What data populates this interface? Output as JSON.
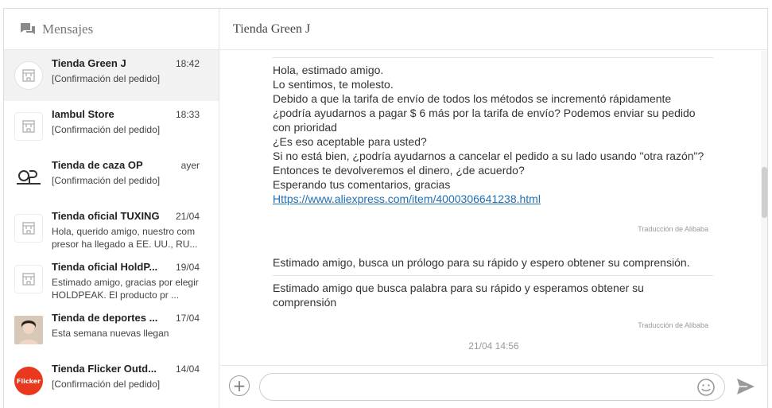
{
  "sidebar": {
    "title": "Mensajes",
    "icon": "chat-bubbles-icon",
    "conversations": [
      {
        "name": "Tienda Green J",
        "time": "18:42",
        "preview": "[Confirmación del pedido]",
        "avatar": "store-icon",
        "active": true
      },
      {
        "name": "Iambul Store",
        "time": "18:33",
        "preview": "[Confirmación del pedido]",
        "avatar": "store-icon"
      },
      {
        "name": "Tienda de caza OP",
        "time": "ayer",
        "preview": "[Confirmación del pedido]",
        "avatar": "op-logo"
      },
      {
        "name": "Tienda oficial TUXING",
        "time": "21/04",
        "preview": "Hola, querido amigo, nuestro com presor ha llegado a EE. UU., RU...",
        "avatar": "store-icon"
      },
      {
        "name": "Tienda oficial HoldP...",
        "time": "19/04",
        "preview": "Estimado amigo, gracias por elegir HOLDPEAK. El producto pr ...",
        "avatar": "store-icon"
      },
      {
        "name": "Tienda de deportes ...",
        "time": "17/04",
        "preview": "Esta semana nuevas llegan",
        "avatar": "person-photo"
      },
      {
        "name": "Tienda Flicker Outd...",
        "time": "14/04",
        "preview": "[Confirmación del pedido]",
        "avatar": "flicker-logo",
        "avatar_text": "Flicker"
      }
    ]
  },
  "chat": {
    "title": "Tienda Green J",
    "messages": [
      {
        "text": "Hola, estimado amigo.\nLo sentimos, te molesto.\nDebido a que la tarifa de envío de todos los métodos se incrementó rápidamente\n¿podría ayudarnos a pagar $ 6 más por la tarifa de envío? Podemos enviar su pedido\ncon prioridad\n¿Es eso aceptable para usted?\nSi no está bien, ¿podría ayudarnos a cancelar el pedido a su lado usando \"otra razón\"?\nEntonces te devolveremos el dinero, ¿de acuerdo?\nEsperando tus comentarios, gracias",
        "link": "Https://www.aliexpress.com/item/4000306641238.html",
        "note": "Traducción de Alibaba"
      },
      {
        "original": "Estimado amigo, busca un prólogo para su rápido y espero obtener su comprensión.",
        "translation": "Estimado amigo que busca palabra para su rápido y esperamos obtener su\ncomprensión",
        "note": "Traducción de Alibaba"
      }
    ],
    "timestamp": "21/04 14:56"
  },
  "composer": {
    "input_value": "",
    "add_icon": "plus-icon",
    "emoji_icon": "smiley-icon",
    "send_icon": "send-icon"
  },
  "colors": {
    "link": "#1f6fb4",
    "active_row": "#f2f2f2",
    "flicker_brand": "#e8391f"
  }
}
